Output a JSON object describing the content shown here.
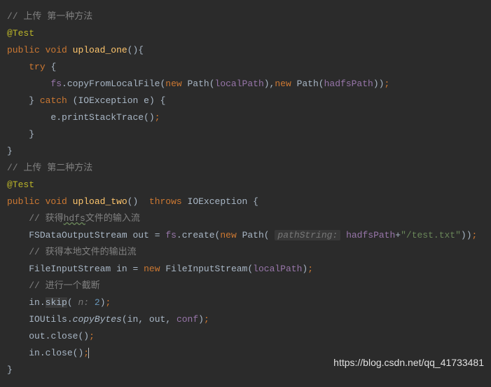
{
  "c1": "// 上传 第一种方法",
  "ann": "@Test",
  "kw_public": "public",
  "kw_void": "void",
  "m1": "upload_one",
  "kw_try": "try",
  "fs": "fs",
  "copyFromLocal": "copyFromLocalFile",
  "kw_new": "new",
  "Path": "Path",
  "localPath": "localPath",
  "hadfsPath": "hadfsPath",
  "kw_catch": "catch",
  "IOException": "IOException",
  "e": "e",
  "printStackTrace": "printStackTrace",
  "c2": "// 上传 第二种方法",
  "m2": "upload_two",
  "kw_throws": "throws",
  "c3": "// 获得",
  "hdfs": "hdfs",
  "c3b": "文件的输入流",
  "FSDataOutputStream": "FSDataOutputStream",
  "out": "out",
  "create": "create",
  "hint_pathString": "pathString:",
  "plus": "+",
  "str_test": "\"/test.txt\"",
  "c4": "// 获得本地文件的输出流",
  "FileInputStream": "FileInputStream",
  "in": "in",
  "c5": "// 进行一个截断",
  "skip": "skip",
  "hint_n": "n:",
  "num2": "2",
  "IOUtils": "IOUtils",
  "copyBytes": "copyBytes",
  "conf": "conf",
  "close": "close",
  "watermark": "https://blog.csdn.net/qq_41733481"
}
